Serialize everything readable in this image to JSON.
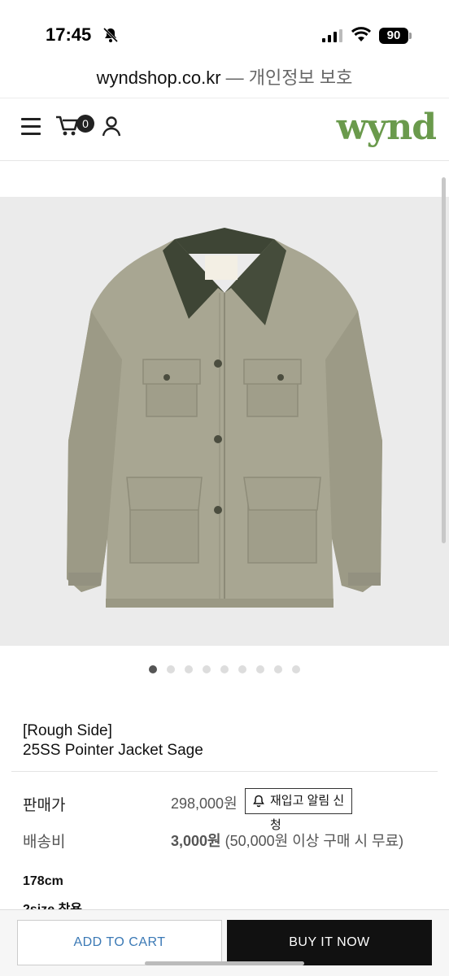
{
  "status_bar": {
    "time": "17:45",
    "battery": "90"
  },
  "browser": {
    "domain": "wyndshop.co.kr",
    "privacy_label": " — 개인정보 보호"
  },
  "header": {
    "cart_count": "0",
    "logo": "wynd"
  },
  "product": {
    "brand": "[Rough Side]",
    "name": "25SS Pointer Jacket Sage",
    "image_count": 9,
    "active_image_index": 0
  },
  "pricing": {
    "price_label": "판매가",
    "price": "298,000원",
    "restock_label": "재입고 알림 신청",
    "shipping_label": "배송비",
    "shipping_amount": "3,000원",
    "shipping_note": " (50,000원 이상 구매 시 무료)"
  },
  "fit_note": {
    "height": "178cm",
    "size": "2size 착용"
  },
  "actions": {
    "add_to_cart": "ADD TO CART",
    "buy_now": "BUY IT NOW"
  },
  "colors": {
    "logo": "#6a9a4c",
    "jacket": "#a8a692",
    "collar": "#3e4535",
    "buy_bg": "#111111",
    "cart_text": "#3b79b5"
  }
}
